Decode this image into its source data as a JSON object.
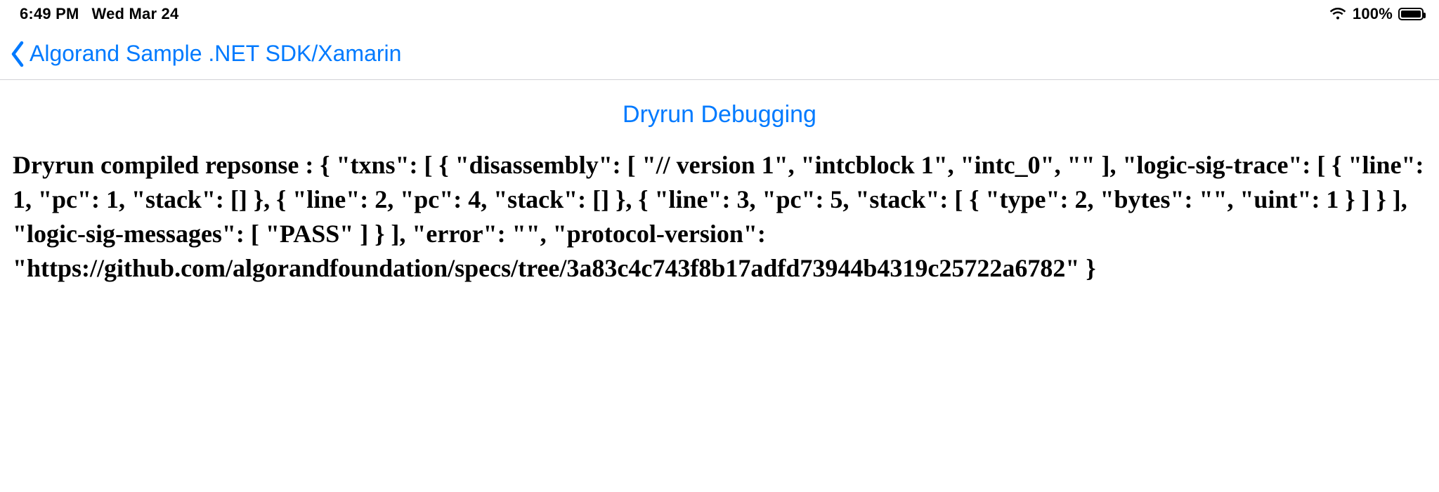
{
  "status_bar": {
    "time": "6:49 PM",
    "date": "Wed Mar 24",
    "battery_pct": "100%"
  },
  "nav": {
    "back_label": "Algorand Sample .NET SDK/Xamarin"
  },
  "page": {
    "title": "Dryrun Debugging"
  },
  "content": {
    "response_text": "Dryrun compiled repsonse : { \"txns\": [ { \"disassembly\": [ \"// version 1\", \"intcblock 1\", \"intc_0\", \"\" ], \"logic-sig-trace\": [ { \"line\": 1, \"pc\": 1, \"stack\": [] }, { \"line\": 2, \"pc\": 4, \"stack\": [] }, { \"line\": 3, \"pc\": 5, \"stack\": [ { \"type\": 2, \"bytes\": \"\", \"uint\": 1 } ] } ], \"logic-sig-messages\": [ \"PASS\" ] } ], \"error\": \"\", \"protocol-version\": \"https://github.com/algorandfoundation/specs/tree/3a83c4c743f8b17adfd73944b4319c25722a6782\" }"
  }
}
